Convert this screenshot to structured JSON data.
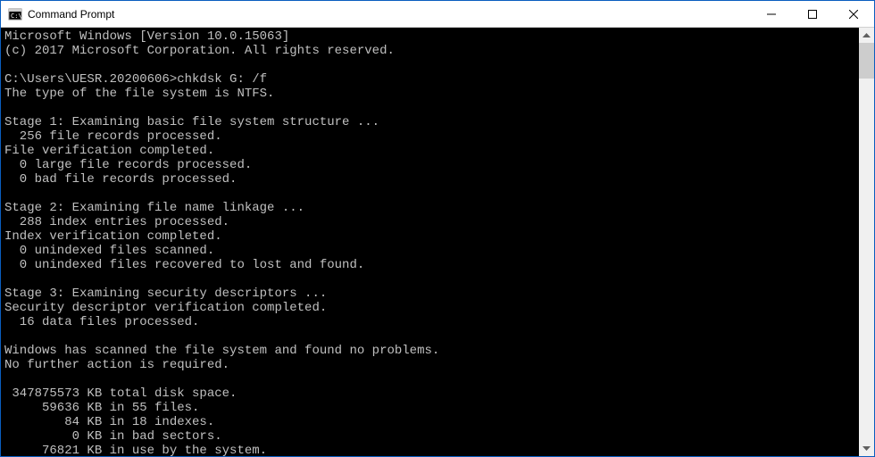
{
  "window": {
    "title": "Command Prompt"
  },
  "terminal": {
    "lines": [
      "Microsoft Windows [Version 10.0.15063]",
      "(c) 2017 Microsoft Corporation. All rights reserved.",
      "",
      "C:\\Users\\UESR.20200606>chkdsk G: /f",
      "The type of the file system is NTFS.",
      "",
      "Stage 1: Examining basic file system structure ...",
      "  256 file records processed.",
      "File verification completed.",
      "  0 large file records processed.",
      "  0 bad file records processed.",
      "",
      "Stage 2: Examining file name linkage ...",
      "  288 index entries processed.",
      "Index verification completed.",
      "  0 unindexed files scanned.",
      "  0 unindexed files recovered to lost and found.",
      "",
      "Stage 3: Examining security descriptors ...",
      "Security descriptor verification completed.",
      "  16 data files processed.",
      "",
      "Windows has scanned the file system and found no problems.",
      "No further action is required.",
      "",
      " 347875573 KB total disk space.",
      "     59636 KB in 55 files.",
      "        84 KB in 18 indexes.",
      "         0 KB in bad sectors.",
      "     76821 KB in use by the system."
    ]
  }
}
